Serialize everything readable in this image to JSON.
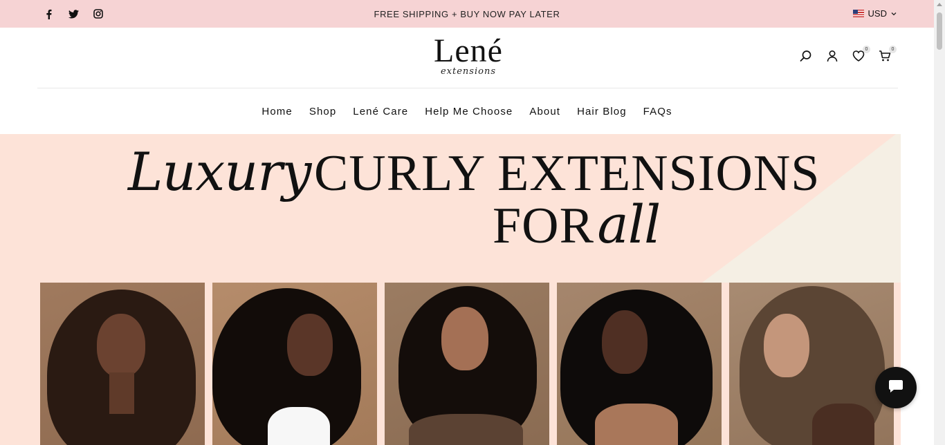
{
  "topbar": {
    "announcement": "FREE SHIPPING + BUY NOW PAY LATER",
    "social_icons": [
      "facebook-icon",
      "twitter-icon",
      "instagram-icon"
    ],
    "currency": "USD",
    "background": "#f6d3d4"
  },
  "header": {
    "logo_main": "Lené",
    "logo_sub": "extensions",
    "wishlist_count": "0",
    "cart_count": "0"
  },
  "nav": {
    "items": [
      "Home",
      "Shop",
      "Lené Care",
      "Help Me Choose",
      "About",
      "Hair Blog",
      "FAQs"
    ]
  },
  "hero": {
    "word_script_1": "Luxury",
    "word_caps_1": "CURLY EXTENSIONS",
    "word_caps_2": "FOR",
    "word_script_2": "all",
    "background": "#fde3d8",
    "accent": "#f5efe4",
    "tiles": [
      "model-1",
      "model-2",
      "model-3",
      "model-4",
      "model-5"
    ]
  },
  "chat": {
    "icon": "chat-bubble-icon"
  }
}
